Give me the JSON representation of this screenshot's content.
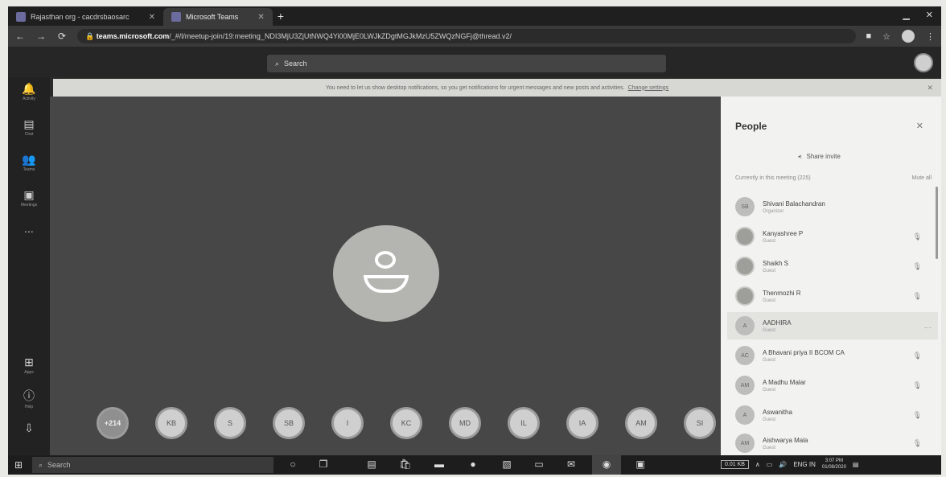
{
  "browser": {
    "tabs": [
      {
        "label": "Rajasthan org - cacdrsbaosarc",
        "active": false
      },
      {
        "label": "Microsoft Teams",
        "active": true
      }
    ],
    "url_host": "teams.microsoft.com",
    "url_path": "/_#/l/meetup-join/19:meeting_NDI3MjU3ZjUtNWQ4Yi00MjE0LWJkZDgtMGJkMzU5ZWQzNGFj@thread.v2/",
    "new_tab": "+"
  },
  "teams": {
    "search_placeholder": "Search"
  },
  "rail": [
    {
      "label": "Activity",
      "icon": "bell-icon"
    },
    {
      "label": "Chat",
      "icon": "chat-icon"
    },
    {
      "label": "Teams",
      "icon": "teams-icon"
    },
    {
      "label": "Meetings",
      "icon": "calendar-icon"
    },
    {
      "label": "...",
      "icon": "more-icon"
    },
    {
      "label": "Apps",
      "icon": "apps-icon"
    },
    {
      "label": "Help",
      "icon": "help-icon"
    },
    {
      "label": "",
      "icon": "download-icon"
    }
  ],
  "banner": {
    "text": "You need to let us show desktop notifications, so you get notifications for urgent messages and new posts and activities.",
    "link": "Change settings"
  },
  "stage": {
    "overflow_count": "+214",
    "tiles": [
      "KB",
      "S",
      "SB",
      "I",
      "KC",
      "MD",
      "IL",
      "IA",
      "AM",
      "SI"
    ]
  },
  "people": {
    "title": "People",
    "share_invite": "Share invite",
    "section": "Currently in this meeting (225)",
    "mute_all": "Mute all",
    "list": [
      {
        "initials": "SB",
        "name": "Shivani Balachandran",
        "role": "Organizer",
        "img": false
      },
      {
        "initials": "",
        "name": "Kanyashree P",
        "role": "Guest",
        "img": true
      },
      {
        "initials": "",
        "name": "Shaikh S",
        "role": "Guest",
        "img": true
      },
      {
        "initials": "",
        "name": "Thenmozhi R",
        "role": "Guest",
        "img": true
      },
      {
        "initials": "A",
        "name": "AADHIRA",
        "role": "Guest",
        "img": false
      },
      {
        "initials": "AC",
        "name": "A Bhavani priya II BCOM CA",
        "role": "Guest",
        "img": false
      },
      {
        "initials": "AM",
        "name": "A Madhu Malar",
        "role": "Guest",
        "img": false
      },
      {
        "initials": "A",
        "name": "Aswanitha",
        "role": "Guest",
        "img": false
      },
      {
        "initials": "AM",
        "name": "Aishwarya Mala",
        "role": "Guest",
        "img": false
      }
    ]
  },
  "taskbar": {
    "search_placeholder": "Search",
    "lang": "ENG IN",
    "time": "3:07 PM",
    "date": "01/08/2020",
    "kb": "0.01 KB"
  }
}
